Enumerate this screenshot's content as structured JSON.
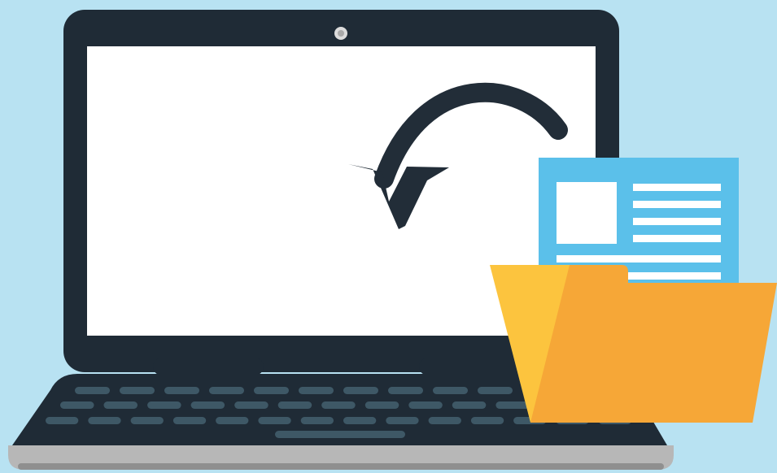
{
  "colors": {
    "background": "#b8e2f2",
    "laptop_bezel": "#1f2b36",
    "laptop_bezel_edge": "#25333f",
    "screen": "#ffffff",
    "camera_outer": "#dcdcdc",
    "camera_inner": "#a9a9a9",
    "keyboard_deck": "#1f2b36",
    "keys": "#3e5866",
    "laptop_base": "#b7b7b7",
    "laptop_base_shadow": "#8f8f8f",
    "arrow": "#222d38",
    "document": "#5bc0ea",
    "document_lines": "#ffffff",
    "folder_back": "#fcc43e",
    "folder_front": "#f6a737"
  },
  "icons": {
    "laptop": "laptop-icon",
    "arrow": "curved-arrow-icon",
    "document": "document-icon",
    "folder": "open-folder-icon"
  }
}
